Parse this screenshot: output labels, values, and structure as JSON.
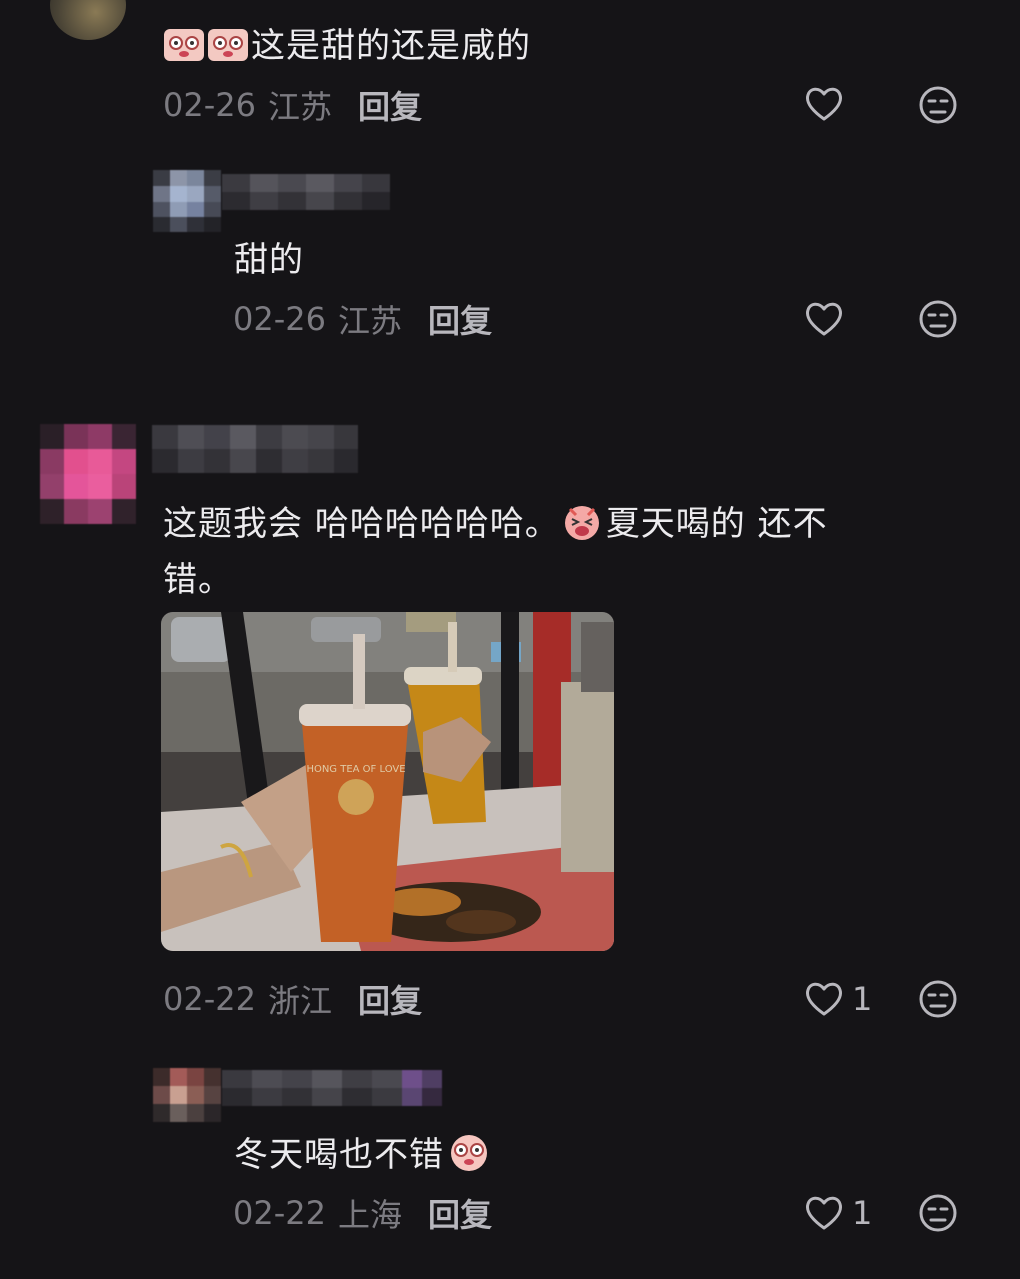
{
  "comments": [
    {
      "text_suffix": "这是甜的还是咸的",
      "emoji": "face-emoji",
      "date": "02-26",
      "location": "江苏",
      "reply_label": "回复"
    },
    {
      "text": "甜的",
      "date": "02-26",
      "location": "江苏",
      "reply_label": "回复"
    },
    {
      "text_line1_a": "这题我会 哈哈哈哈哈哈。",
      "text_line1_b": "夏天喝的 还不",
      "text_line2": "错。",
      "photo_cup_text": "HONG TEA OF LOVE",
      "date": "02-22",
      "location": "浙江",
      "reply_label": "回复",
      "like_count": "1"
    },
    {
      "text": "冬天喝也不错",
      "date": "02-22",
      "location": "上海",
      "reply_label": "回复",
      "like_count": "1"
    }
  ],
  "colors": {
    "background": "#151417",
    "text": "#ecebee",
    "meta": "#7c7b81",
    "reply": "#b8b7bd"
  }
}
